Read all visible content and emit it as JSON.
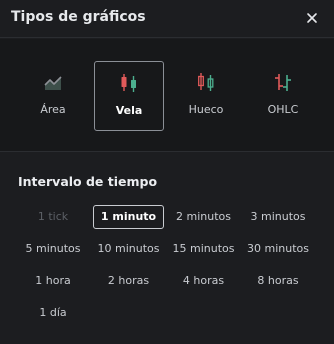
{
  "dialog": {
    "title": "Tipos de gráficos"
  },
  "chart_types": [
    {
      "label": "Área",
      "icon": "area-chart-icon",
      "selected": false
    },
    {
      "label": "Vela",
      "icon": "candlestick-icon",
      "selected": true
    },
    {
      "label": "Hueco",
      "icon": "hollow-candle-icon",
      "selected": false
    },
    {
      "label": "OHLC",
      "icon": "ohlc-icon",
      "selected": false
    }
  ],
  "interval": {
    "title": "Intervalo de tiempo",
    "options": [
      {
        "label": "1 tick",
        "state": "disabled"
      },
      {
        "label": "1 minuto",
        "state": "selected"
      },
      {
        "label": "2 minutos",
        "state": "normal"
      },
      {
        "label": "3 minutos",
        "state": "normal"
      },
      {
        "label": "5 minutos",
        "state": "normal"
      },
      {
        "label": "10 minutos",
        "state": "normal"
      },
      {
        "label": "15 minutos",
        "state": "normal"
      },
      {
        "label": "30 minutos",
        "state": "normal"
      },
      {
        "label": "1 hora",
        "state": "normal"
      },
      {
        "label": "2 horas",
        "state": "normal"
      },
      {
        "label": "4 horas",
        "state": "normal"
      },
      {
        "label": "8 horas",
        "state": "normal"
      },
      {
        "label": "1 día",
        "state": "normal"
      }
    ]
  },
  "colors": {
    "up": "#4caf8f",
    "down": "#e05a5a",
    "neutral": "#8d9096"
  }
}
